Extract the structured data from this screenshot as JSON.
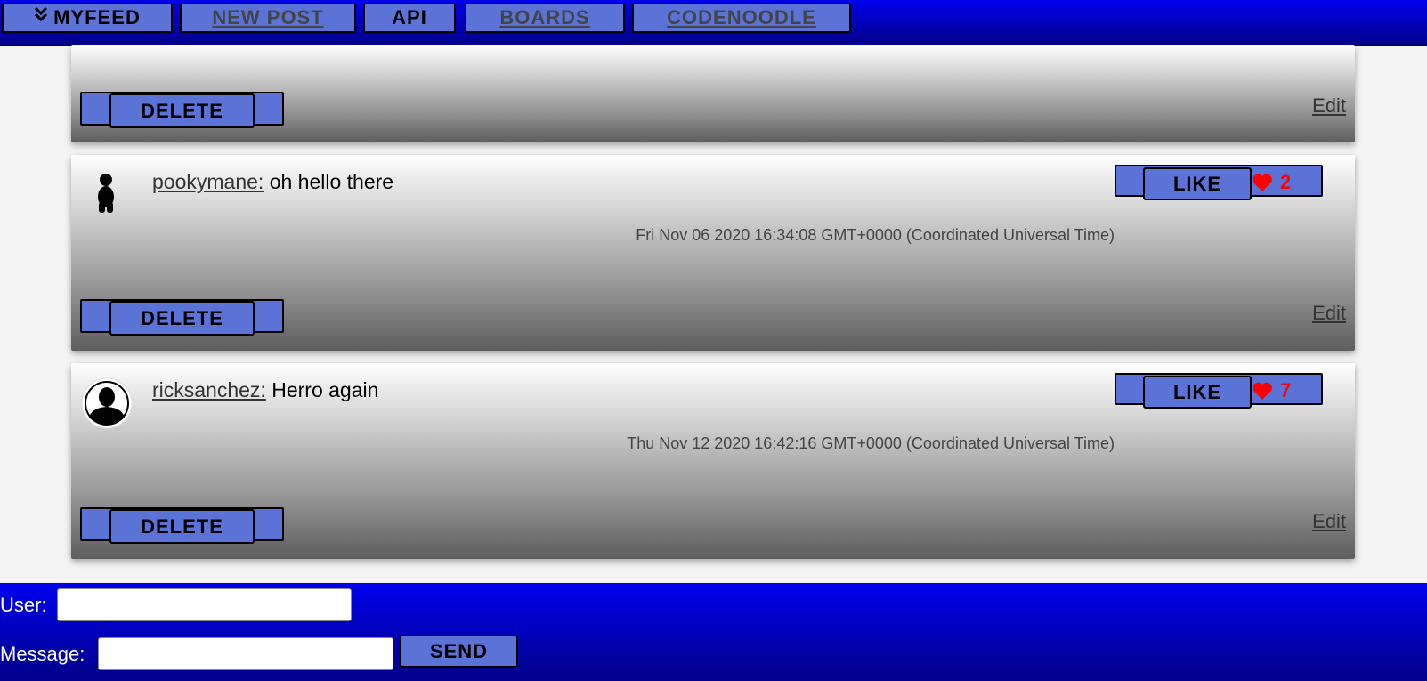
{
  "nav": {
    "myfeed": "MYFEED",
    "new_post": "NEW POST",
    "api": "API",
    "boards": "BOARDS",
    "codenoodle": "CODENOODLE"
  },
  "posts": [
    {
      "delete_label": "DELETE",
      "edit_label": "Edit"
    },
    {
      "username": "pookymane:",
      "message": "oh hello there",
      "timestamp": "Fri Nov 06 2020 16:34:08 GMT+0000 (Coordinated Universal Time)",
      "like_label": "LIKE",
      "likes": "2",
      "delete_label": "DELETE",
      "edit_label": "Edit",
      "avatar": "person-figure-icon"
    },
    {
      "username": "ricksanchez:",
      "message": "Herro again",
      "timestamp": "Thu Nov 12 2020 16:42:16 GMT+0000 (Coordinated Universal Time)",
      "like_label": "LIKE",
      "likes": "7",
      "delete_label": "DELETE",
      "edit_label": "Edit",
      "avatar": "user-silhouette-icon"
    }
  ],
  "form": {
    "user_label": "User:",
    "user_value": "",
    "message_label": "Message:",
    "message_value": "",
    "send_label": "SEND"
  },
  "colors": {
    "nav_gradient_top": "#0000ee",
    "button_fill": "#5b72d6",
    "like_heart": "#ff0000"
  }
}
